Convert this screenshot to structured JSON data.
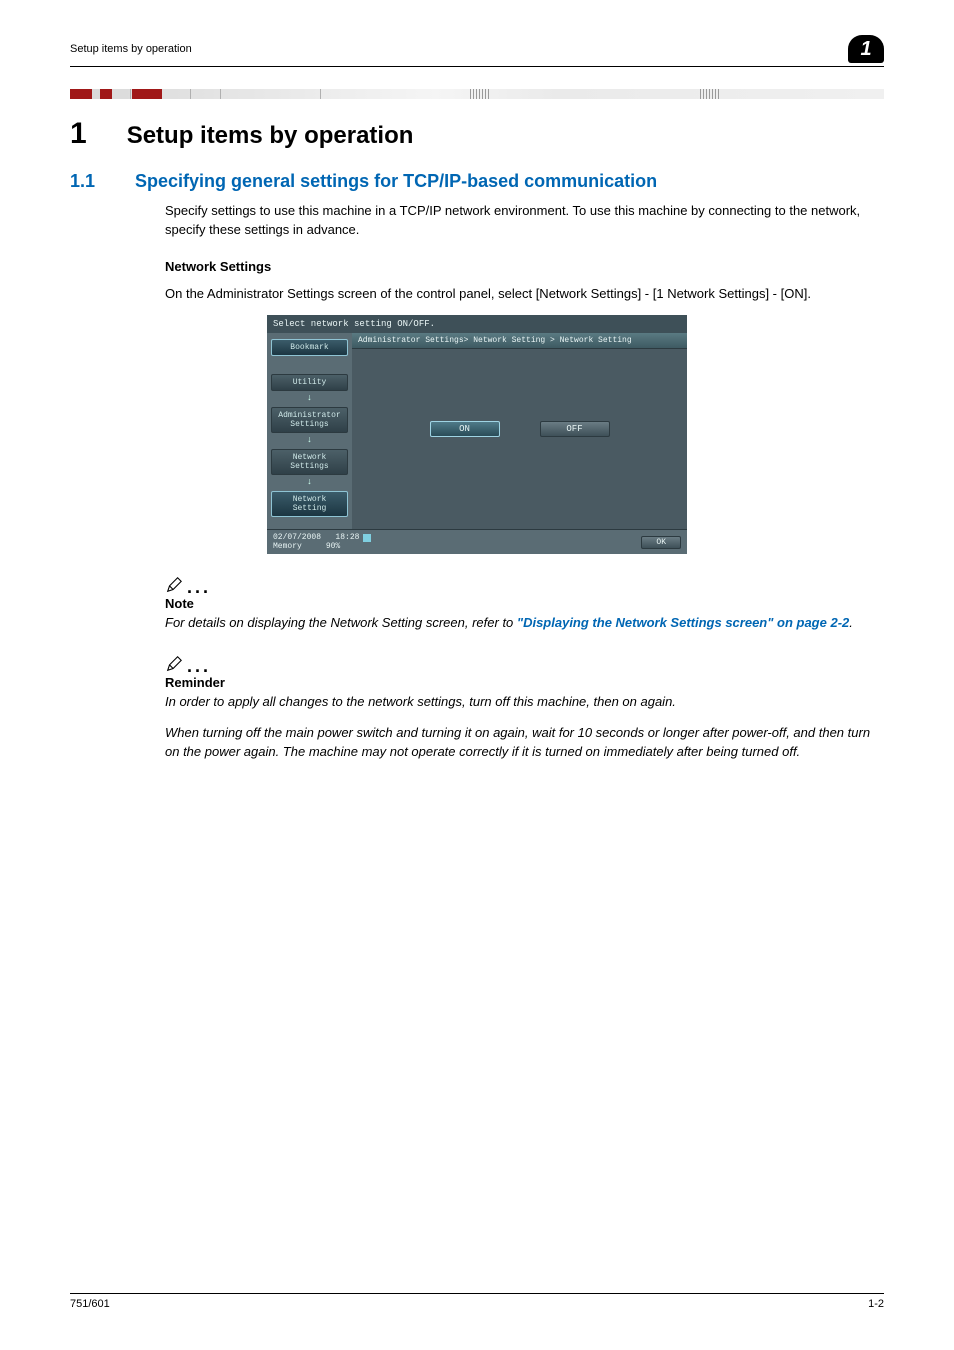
{
  "header": {
    "running_title": "Setup items by operation",
    "page_badge": "1"
  },
  "h1": {
    "num": "1",
    "text": "Setup items by operation"
  },
  "h2": {
    "num": "1.1",
    "text": "Specifying general settings for TCP/IP-based communication"
  },
  "intro": "Specify settings to use this machine in a TCP/IP network environment. To use this machine by connecting to the network, specify these settings in advance.",
  "h3": "Network Settings",
  "para1": "On the Administrator Settings screen of the control panel, select [Network Settings] - [1 Network Settings] - [ON].",
  "screenshot": {
    "instruction": "Select network setting ON/OFF.",
    "breadcrumb": "Administrator Settings> Network Setting > Network Setting",
    "sidebar": {
      "bookmark": "Bookmark",
      "utility": "Utility",
      "admin": "Administrator Settings",
      "netsettings": "Network Settings",
      "netsetting": "Network Setting"
    },
    "on_label": "ON",
    "off_label": "OFF",
    "date": "02/07/2008",
    "time": "18:28",
    "memory_label": "Memory",
    "memory_value": "90%",
    "ok_label": "OK"
  },
  "note1": {
    "title": "Note",
    "pre": "For details on displaying the Network Setting screen, refer to ",
    "link": "\"Displaying the Network Settings screen\" on page 2-2",
    "post": "."
  },
  "note2": {
    "title": "Reminder",
    "p1": "In order to apply all changes to the network settings, turn off this machine, then on again.",
    "p2": "When turning off the main power switch and turning it on again, wait for 10 seconds or longer after power-off, and then turn on the power again. The machine may not operate correctly if it is turned on immediately after being turned off."
  },
  "footer": {
    "left": "751/601",
    "right": "1-2"
  }
}
